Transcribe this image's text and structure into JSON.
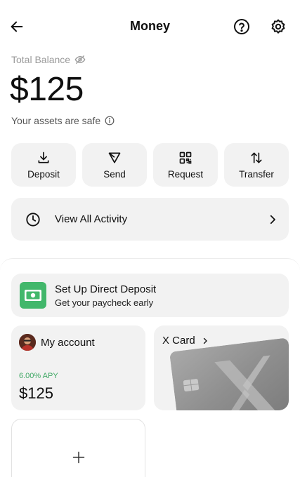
{
  "header": {
    "title": "Money",
    "back_icon": "arrow-left-icon",
    "help_icon": "question-circle-icon",
    "settings_icon": "gear-icon"
  },
  "balance": {
    "label": "Total Balance",
    "hide_icon": "eye-slash-icon",
    "amount": "$125",
    "safe_text": "Your assets are safe",
    "info_icon": "info-icon"
  },
  "actions": [
    {
      "label": "Deposit",
      "icon": "download-icon"
    },
    {
      "label": "Send",
      "icon": "send-icon"
    },
    {
      "label": "Request",
      "icon": "qr-code-icon"
    },
    {
      "label": "Transfer",
      "icon": "swap-arrows-icon"
    }
  ],
  "activity": {
    "label": "View All Activity",
    "icon": "clock-icon",
    "chevron": "chevron-right-icon"
  },
  "direct_deposit": {
    "title": "Set Up Direct Deposit",
    "subtitle": "Get your paycheck early",
    "icon": "cash-icon",
    "icon_color": "#42b76b"
  },
  "account": {
    "title": "My account",
    "apy": "6.00% APY",
    "balance": "$125",
    "apy_color": "#3ea864"
  },
  "xcard": {
    "title": "X Card",
    "chevron": "chevron-right-icon"
  },
  "add_card": {
    "icon": "plus-icon"
  }
}
